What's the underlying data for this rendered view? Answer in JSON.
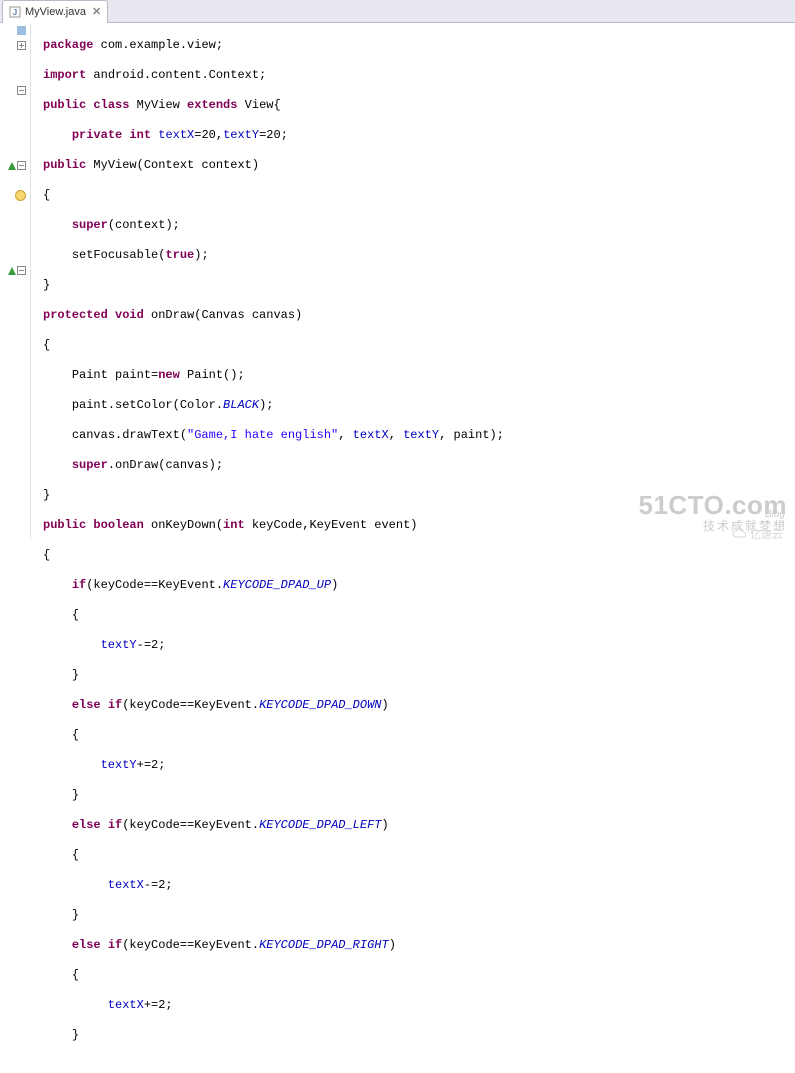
{
  "tab": {
    "label": "MyView.java",
    "close": "✕"
  },
  "code": {
    "package_kw": "package",
    "package_name": " com.example.view;",
    "import_kw": "import",
    "import_name": " android.content.Context;",
    "public_kw": "public",
    "class_kw": " class",
    "class_name": " MyView ",
    "extends_kw": "extends",
    "extends_name": " View{",
    "private_kw": "private",
    "int_kw": " int",
    "field_textx": " textX",
    "eq20a": "=20,",
    "field_texty": "textY",
    "eq20b": "=20;",
    "ctor_sig": " MyView(Context context)",
    "brace_open": "{",
    "brace_close": "}",
    "super_kw": "super",
    "super_ctx": "(context);",
    "setfocus": "setFocusable(",
    "true_kw": "true",
    "closeparen": ");",
    "protected_kw": "protected",
    "void_kw": " void",
    "ondraw_sig": " onDraw(Canvas canvas)",
    "paint_decl_a": "Paint paint=",
    "new_kw": "new",
    "paint_decl_b": " Paint();",
    "setcolor_a": "paint.setColor(Color.",
    "black_const": "BLACK",
    "setcolor_b": ");",
    "drawtext_a": "canvas.drawText(",
    "drawtext_str": "\"Game,I hate english\"",
    "drawtext_b": ",",
    "drawtext_c": ", ",
    "drawtext_d": ", paint);",
    "super_ondraw": ".onDraw(canvas);",
    "boolean_kw": " boolean",
    "onkeydown_a": " onKeyDown(",
    "onkeydown_b": " keyCode,KeyEvent event)",
    "if_kw": "if",
    "else_kw": "else",
    "cond_a": "(keyCode==KeyEvent.",
    "kc_up": "KEYCODE_DPAD_UP",
    "kc_down": "KEYCODE_DPAD_DOWN",
    "kc_left": "KEYCODE_DPAD_LEFT",
    "kc_right": "KEYCODE_DPAD_RIGHT",
    "cond_b": ")",
    "texty_minus": "-=2;",
    "texty_plus": "+=2;",
    "textx_minus": "-=2;",
    "textx_plus": "+=2;"
  },
  "watermark": {
    "main": "51CTO.com",
    "sub": "技术成就梦想",
    "blog": "Blog",
    "wm2": "亿速云"
  }
}
